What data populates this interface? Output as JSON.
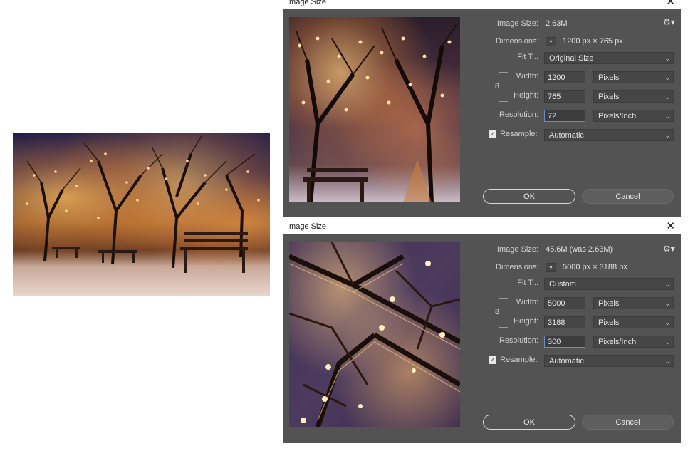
{
  "photo": {
    "name": "winter-night-park-photo"
  },
  "dialogs": [
    {
      "title": "Image Size",
      "close": "✕",
      "image_size_label": "Image Size:",
      "image_size_value": "2.63M",
      "dimensions_label": "Dimensions:",
      "dimensions_value": "1200 px  ×  765 px",
      "fit_label": "Fit T...",
      "fit_value": "Original Size",
      "width_label": "Width:",
      "width_value": "1200",
      "width_unit": "Pixels",
      "height_label": "Height:",
      "height_value": "765",
      "height_unit": "Pixels",
      "resolution_label": "Resolution:",
      "resolution_value": "72",
      "resolution_unit": "Pixels/Inch",
      "resample_label": "Resample:",
      "resample_value": "Automatic",
      "ok_label": "OK",
      "cancel_label": "Cancel"
    },
    {
      "title": "Image Size",
      "close": "✕",
      "image_size_label": "Image Size:",
      "image_size_value": "45.6M (was 2.63M)",
      "dimensions_label": "Dimensions:",
      "dimensions_value": "5000 px  ×  3188 px",
      "fit_label": "Fit T...",
      "fit_value": "Custom",
      "width_label": "Width:",
      "width_value": "5000",
      "width_unit": "Pixels",
      "height_label": "Height:",
      "height_value": "3188",
      "height_unit": "Pixels",
      "resolution_label": "Resolution:",
      "resolution_value": "300",
      "resolution_unit": "Pixels/Inch",
      "resample_label": "Resample:",
      "resample_value": "Automatic",
      "ok_label": "OK",
      "cancel_label": "Cancel"
    }
  ],
  "icons": {
    "gear": "gear-icon",
    "chevron": "chevron-down-icon",
    "link": "chain-link-icon",
    "check": "checkmark-icon"
  }
}
